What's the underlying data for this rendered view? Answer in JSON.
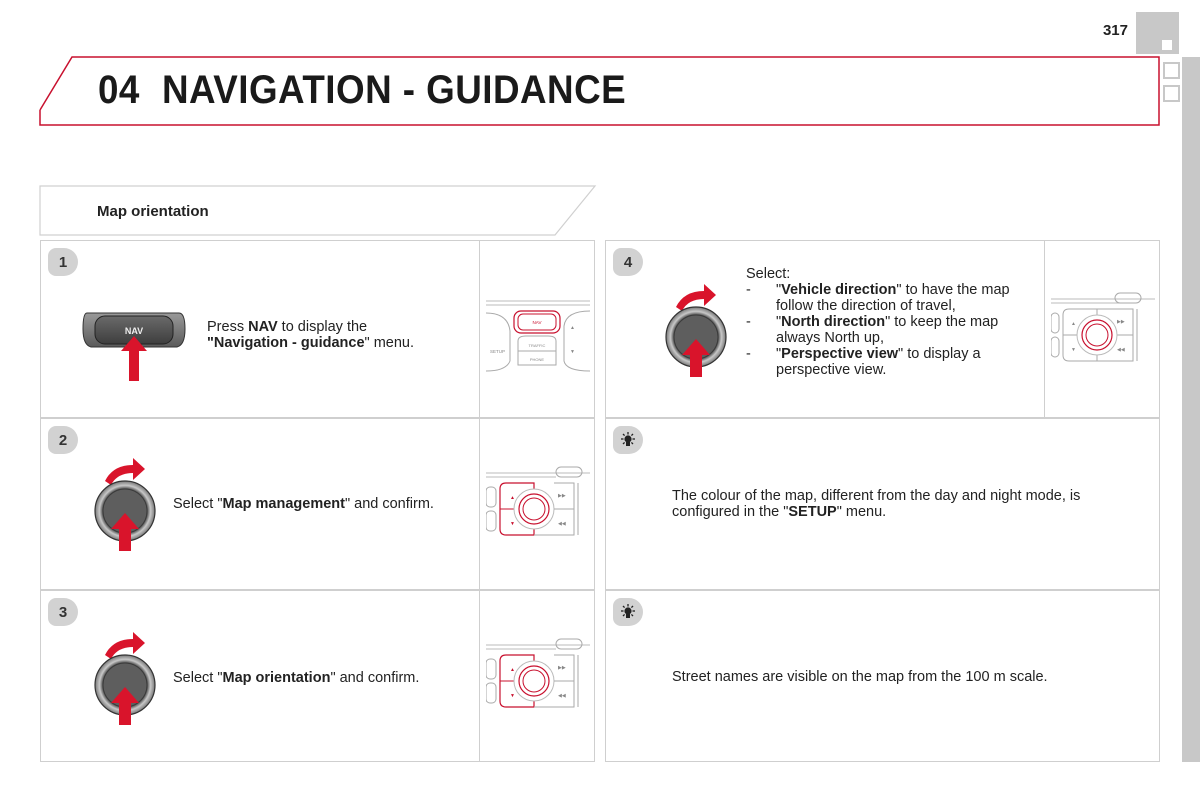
{
  "header": {
    "page_number": "317",
    "chapter_number": "04",
    "chapter_title": "NAVIGATION - GUIDANCE"
  },
  "section": {
    "title": "Map orientation"
  },
  "steps": [
    {
      "number": "1",
      "icon": "nav-button-press-icon",
      "button_label": "NAV",
      "text_parts": [
        "Press ",
        "NAV",
        " to display the",
        "\"",
        "Navigation - guidance",
        "\" menu."
      ],
      "diagram_labels": [
        "NAV",
        "TRAFFIC",
        "PHONE",
        "SETUP"
      ]
    },
    {
      "number": "2",
      "icon": "rotary-knob-icon",
      "text_parts": [
        "Select \"",
        "Map management",
        "\" and confirm."
      ]
    },
    {
      "number": "3",
      "icon": "rotary-knob-icon",
      "text_parts": [
        "Select \"",
        "Map orientation",
        "\" and confirm."
      ]
    },
    {
      "number": "4",
      "icon": "rotary-knob-icon",
      "intro": "Select:",
      "options": [
        {
          "dash": "-",
          "pre": "\"",
          "bold": "Vehicle direction",
          "post": "\" to have the map follow the direction of travel,"
        },
        {
          "dash": "-",
          "pre": "\"",
          "bold": "North direction",
          "post": "\" to keep the map always North up,"
        },
        {
          "dash": "-",
          "pre": "\"",
          "bold": "Perspective view",
          "post": "\" to display a perspective view."
        }
      ]
    }
  ],
  "tips": [
    {
      "icon": "lightbulb-icon",
      "text_parts": [
        "The colour of the map, different from the day and night mode, is configured in the \"",
        "SETUP",
        "\" menu."
      ]
    },
    {
      "icon": "lightbulb-icon",
      "text": "Street names are visible on the map from the 100 m scale."
    }
  ],
  "colors": {
    "accent_red": "#c8102e",
    "badge_grey": "#d2d2d2",
    "border_grey": "#cfcfcf",
    "sidebar_grey": "#c8c8c8"
  }
}
